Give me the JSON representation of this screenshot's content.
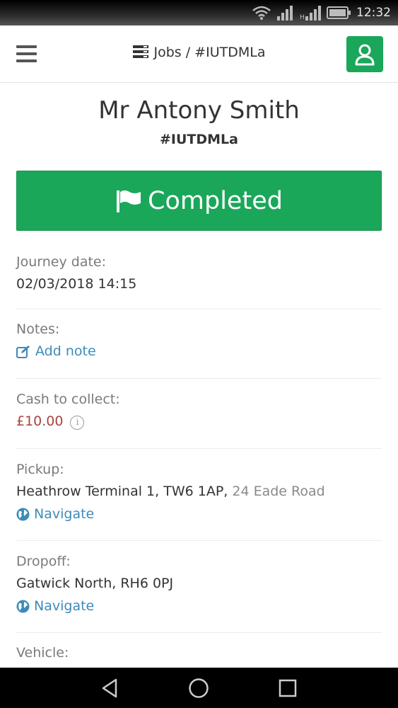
{
  "status_bar": {
    "time": "12:32",
    "icons": [
      "wifi-icon",
      "signal-icon",
      "signal-icon",
      "battery-icon"
    ]
  },
  "header": {
    "menu_icon": "hamburger-menu-icon",
    "breadcrumb_icon": "server-list-icon",
    "title": "Jobs / #IUTDMLa",
    "user_icon": "user-icon",
    "accent_color": "#1aa75a"
  },
  "job": {
    "customer_name": "Mr Antony Smith",
    "reference": "#IUTDMLa",
    "status": "Completed",
    "status_icon": "flag-icon",
    "status_color": "#1aa75a"
  },
  "fields": {
    "journey_date": {
      "label": "Journey date:",
      "value": "02/03/2018 14:15"
    },
    "notes": {
      "label": "Notes:",
      "link": "Add note",
      "link_icon": "edit-icon"
    },
    "cash": {
      "label": "Cash to collect:",
      "value": "£10.00",
      "icon": "info-icon",
      "value_color": "#a94442"
    },
    "pickup": {
      "label": "Pickup:",
      "place": "Heathrow Terminal 1, TW6 1AP,",
      "address": "24 Eade Road",
      "link": "Navigate",
      "link_icon": "globe-icon"
    },
    "dropoff": {
      "label": "Dropoff:",
      "place": "Gatwick North, RH6 0PJ",
      "link": "Navigate",
      "link_icon": "globe-icon"
    },
    "vehicle": {
      "label": "Vehicle:"
    }
  },
  "nav_bar": {
    "buttons": [
      "back-icon",
      "home-icon",
      "recents-icon"
    ]
  }
}
